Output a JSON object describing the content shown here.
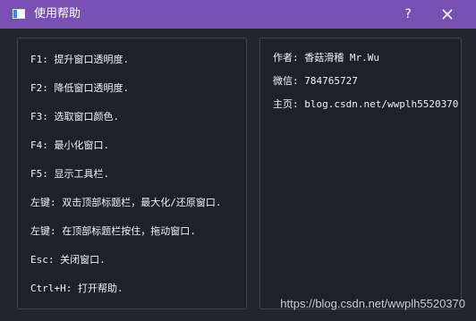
{
  "window": {
    "title": "使用帮助",
    "help_label": "?"
  },
  "shortcuts": [
    "F1: 提升窗口透明度.",
    "F2: 降低窗口透明度.",
    "F3: 选取窗口颜色.",
    "F4: 最小化窗口.",
    "F5: 显示工具栏.",
    "左键: 双击顶部标题栏，最大化/还原窗口.",
    "左键: 在顶部标题栏按住，拖动窗口.",
    "Esc: 关闭窗口.",
    "Ctrl+H: 打开帮助."
  ],
  "about": {
    "author": "作者: 香菇滑稽 Mr.Wu",
    "wechat": "微信: 784765727",
    "homepage": "主页: blog.csdn.net/wwplh5520370"
  },
  "watermark": "https://blog.csdn.net/wwplh5520370",
  "colors": {
    "titlebar": "#7a4fb3",
    "background": "#1f262d",
    "panel_border": "#3a4550",
    "text": "#f0f2f4"
  }
}
